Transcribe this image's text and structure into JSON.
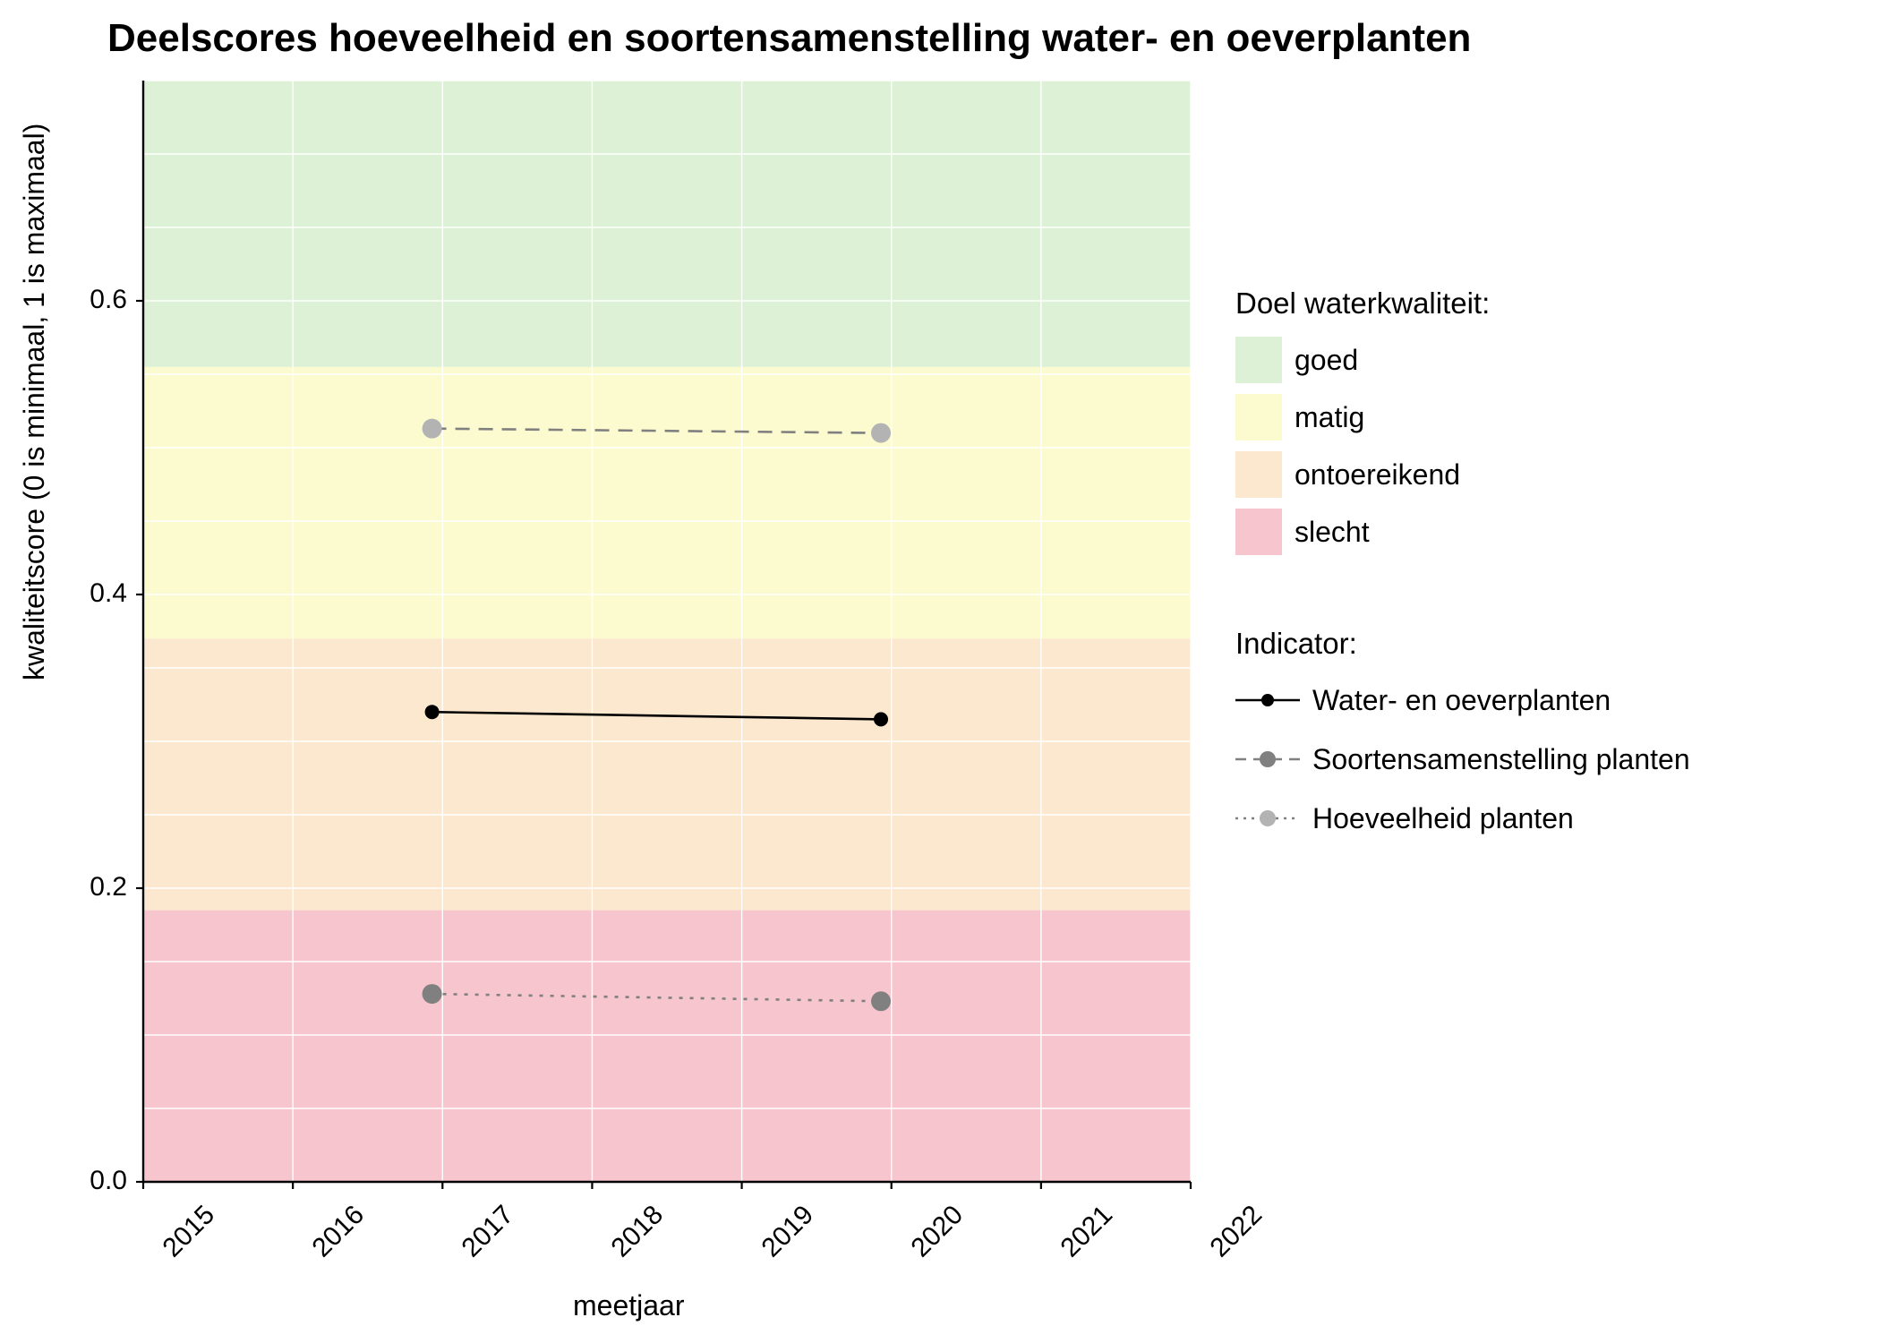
{
  "chart_data": {
    "type": "line",
    "title": "Deelscores hoeveelheid en soortensamenstelling water- en oeverplanten",
    "xlabel": "meetjaar",
    "ylabel": "kwaliteitscore (0 is minimaal, 1 is maximaal)",
    "xlim": [
      2015,
      2022
    ],
    "ylim": [
      0.0,
      0.75
    ],
    "x_ticks": [
      2015,
      2016,
      2017,
      2018,
      2019,
      2020,
      2021,
      2022
    ],
    "y_ticks": [
      0.0,
      0.2,
      0.4,
      0.6
    ],
    "y_gridlines": [
      0.0,
      0.05,
      0.1,
      0.15,
      0.2,
      0.25,
      0.3,
      0.35,
      0.4,
      0.45,
      0.5,
      0.55,
      0.6,
      0.65,
      0.7,
      0.75
    ],
    "bands": [
      {
        "label": "slecht",
        "from": 0.0,
        "to": 0.185,
        "color": "#F6C5CE"
      },
      {
        "label": "ontoereikend",
        "from": 0.185,
        "to": 0.37,
        "color": "#FCE7CF"
      },
      {
        "label": "matig",
        "from": 0.37,
        "to": 0.555,
        "color": "#FCFBD0"
      },
      {
        "label": "goed",
        "from": 0.555,
        "to": 0.8,
        "color": "#DCF1D5"
      }
    ],
    "series": [
      {
        "name": "Water- en oeverplanten",
        "linestyle": "solid",
        "marker_color": "#000000",
        "line_color": "#000000",
        "x": [
          2017,
          2020
        ],
        "y": [
          0.32,
          0.315
        ]
      },
      {
        "name": "Soortensamenstelling planten",
        "linestyle": "dotted",
        "marker_color": "#808080",
        "line_color": "#808080",
        "x": [
          2017,
          2020
        ],
        "y": [
          0.128,
          0.123
        ]
      },
      {
        "name": "Hoeveelheid planten",
        "linestyle": "dashed",
        "marker_color": "#B3B3B3",
        "line_color": "#808080",
        "x": [
          2017,
          2020
        ],
        "y": [
          0.513,
          0.51
        ]
      }
    ],
    "legend1": {
      "title": "Doel waterkwaliteit:",
      "items": [
        "goed",
        "matig",
        "ontoereikend",
        "slecht"
      ]
    },
    "legend2": {
      "title": "Indicator:",
      "items": [
        "Water- en oeverplanten",
        "Soortensamenstelling planten",
        "Hoeveelheid planten"
      ]
    }
  }
}
